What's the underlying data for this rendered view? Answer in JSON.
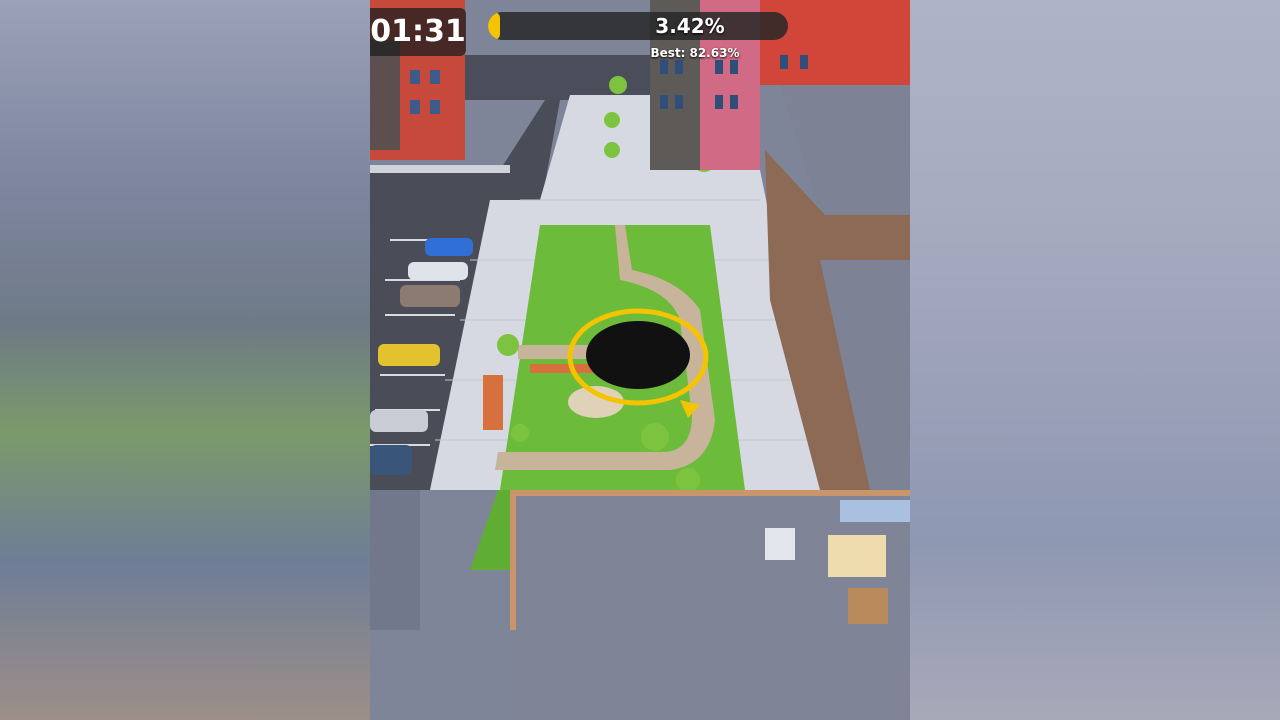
{
  "hud": {
    "timer": "01:31",
    "progress_percent": 3.42,
    "progress_text": "3.42%",
    "best_label": "Best:",
    "best_value": "82.63%"
  },
  "colors": {
    "accent": "#f5c400",
    "grass": "#6dbb3a",
    "path": "#c8b49a",
    "sidewalk": "#d6d9e2",
    "road": "#4a4d58",
    "hole": "#111111"
  },
  "icons": {
    "hole": "black-hole-icon",
    "direction": "yellow-arrow-icon"
  }
}
